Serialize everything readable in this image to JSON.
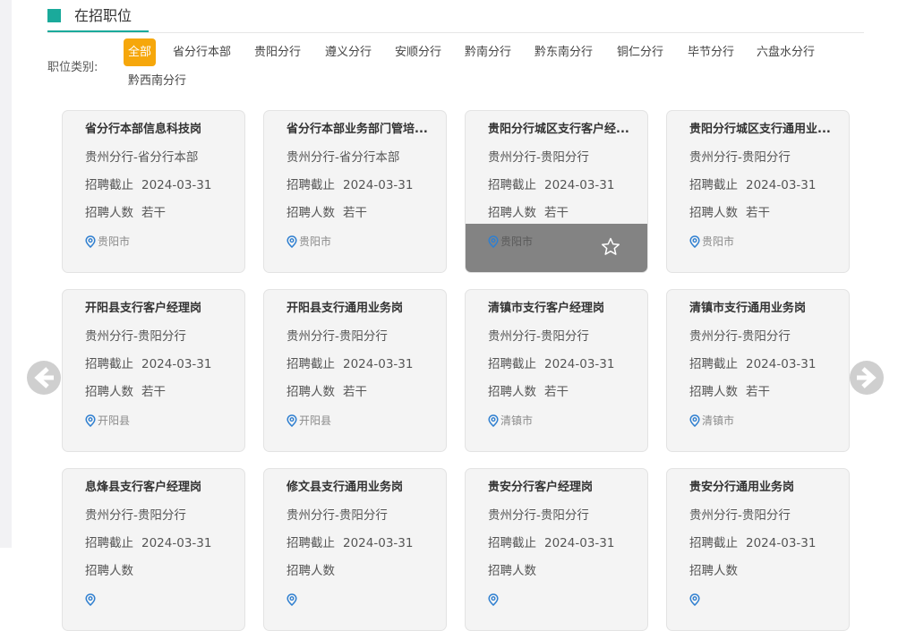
{
  "section": {
    "title": "在招职位"
  },
  "filter": {
    "label": "职位类别:",
    "items": [
      "全部",
      "省分行本部",
      "贵阳分行",
      "遵义分行",
      "安顺分行",
      "黔南分行",
      "黔东南分行",
      "铜仁分行",
      "毕节分行",
      "六盘水分行",
      "黔西南分行"
    ],
    "active_index": 0
  },
  "labels": {
    "deadline": "招聘截止",
    "headcount": "招聘人数"
  },
  "jobs": [
    {
      "title": "省分行本部信息科技岗",
      "dept": "贵州分行-省分行本部",
      "deadline": "2024-03-31",
      "headcount": "若干",
      "location": "贵阳市"
    },
    {
      "title": "省分行本部业务部门管培...",
      "dept": "贵州分行-省分行本部",
      "deadline": "2024-03-31",
      "headcount": "若干",
      "location": "贵阳市"
    },
    {
      "title": "贵阳分行城区支行客户经...",
      "dept": "贵州分行-贵阳分行",
      "deadline": "2024-03-31",
      "headcount": "若干",
      "location": "贵阳市"
    },
    {
      "title": "贵阳分行城区支行通用业...",
      "dept": "贵州分行-贵阳分行",
      "deadline": "2024-03-31",
      "headcount": "若干",
      "location": "贵阳市"
    },
    {
      "title": "开阳县支行客户经理岗",
      "dept": "贵州分行-贵阳分行",
      "deadline": "2024-03-31",
      "headcount": "若干",
      "location": "开阳县"
    },
    {
      "title": "开阳县支行通用业务岗",
      "dept": "贵州分行-贵阳分行",
      "deadline": "2024-03-31",
      "headcount": "若干",
      "location": "开阳县"
    },
    {
      "title": "清镇市支行客户经理岗",
      "dept": "贵州分行-贵阳分行",
      "deadline": "2024-03-31",
      "headcount": "若干",
      "location": "清镇市"
    },
    {
      "title": "清镇市支行通用业务岗",
      "dept": "贵州分行-贵阳分行",
      "deadline": "2024-03-31",
      "headcount": "若干",
      "location": "清镇市"
    },
    {
      "title": "息烽县支行客户经理岗",
      "dept": "贵州分行-贵阳分行",
      "deadline": "2024-03-31",
      "headcount": "",
      "location": ""
    },
    {
      "title": "修文县支行通用业务岗",
      "dept": "贵州分行-贵阳分行",
      "deadline": "2024-03-31",
      "headcount": "",
      "location": ""
    },
    {
      "title": "贵安分行客户经理岗",
      "dept": "贵州分行-贵阳分行",
      "deadline": "2024-03-31",
      "headcount": "",
      "location": ""
    },
    {
      "title": "贵安分行通用业务岗",
      "dept": "贵州分行-贵阳分行",
      "deadline": "2024-03-31",
      "headcount": "",
      "location": ""
    }
  ],
  "hovered_job_index": 2,
  "colors": {
    "accent": "#1aaa9b",
    "active_filter": "#f6a70b",
    "pin": "#2f7fd0"
  },
  "icons": {
    "prev": "chevron-left-circle-icon",
    "next": "chevron-right-circle-icon",
    "favorite": "star-outline-icon",
    "location": "map-pin-icon"
  }
}
